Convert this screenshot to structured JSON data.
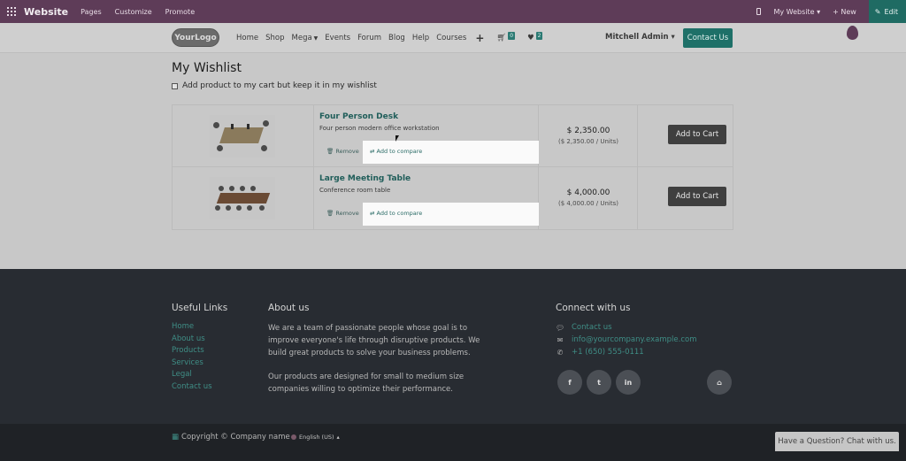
{
  "adminbar": {
    "brand": "Website",
    "menu": [
      "Pages",
      "Customize",
      "Promote"
    ],
    "website_selector": "My Website",
    "new_label": "New",
    "edit_label": "Edit"
  },
  "header": {
    "logo_text": "YourLogo",
    "nav": [
      "Home",
      "Shop",
      "Mega",
      "Events",
      "Forum",
      "Blog",
      "Help",
      "Courses"
    ],
    "cart_count": "0",
    "wishlist_count": "2",
    "user_name": "Mitchell Admin",
    "contact_label": "Contact Us"
  },
  "main": {
    "title": "My Wishlist",
    "keep_label": "Add product to my cart but keep it in my wishlist",
    "items": [
      {
        "name": "Four Person Desk",
        "description": "Four person modern office workstation",
        "remove_label": "Remove",
        "compare_label": "Add to compare",
        "price": "$ 2,350.00",
        "unit_price": "($ 2,350.00 / Units)",
        "add_to_cart": "Add to Cart"
      },
      {
        "name": "Large Meeting Table",
        "description": "Conference room table",
        "remove_label": "Remove",
        "compare_label": "Add to compare",
        "price": "$ 4,000.00",
        "unit_price": "($ 4,000.00 / Units)",
        "add_to_cart": "Add to Cart"
      }
    ]
  },
  "footer": {
    "useful_links_title": "Useful Links",
    "useful_links": [
      "Home",
      "About us",
      "Products",
      "Services",
      "Legal",
      "Contact us"
    ],
    "about_title": "About us",
    "about_p1": "We are a team of passionate people whose goal is to improve everyone's life through disruptive products. We build great products to solve your business problems.",
    "about_p2": "Our products are designed for small to medium size companies willing to optimize their performance.",
    "connect_title": "Connect with us",
    "contact_link": "Contact us",
    "email": "info@yourcompany.example.com",
    "phone": "+1 (650) 555-0111",
    "social": [
      "f",
      "t",
      "in"
    ]
  },
  "bottombar": {
    "copyright": "Copyright © Company name",
    "language": "English (US)",
    "chat": "Have a Question? Chat with us."
  },
  "colors": {
    "admin_bar": "#5e3c58",
    "accent": "#1e7068",
    "footer": "#282c32"
  }
}
